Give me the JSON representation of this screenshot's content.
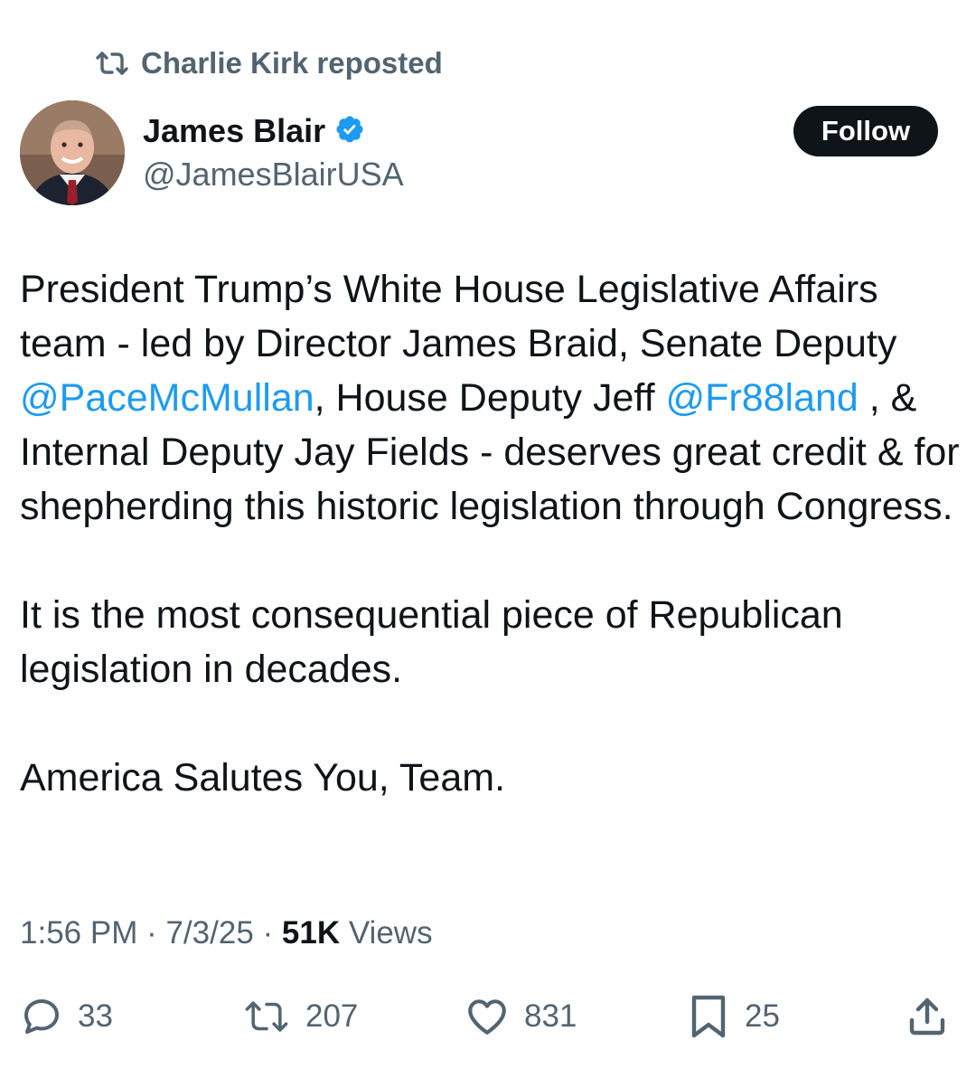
{
  "repost": {
    "icon": "repost-icon",
    "text": "Charlie Kirk reposted"
  },
  "author": {
    "display_name": "James Blair",
    "handle": "@JamesBlairUSA",
    "verified_icon": "verified-badge-icon",
    "verified_color": "#1d9bf0"
  },
  "follow_button": {
    "label": "Follow"
  },
  "tweet": {
    "p1_a": "President Trump’s White House Legislative Affairs team - led by Director James Braid, Senate Deputy ",
    "mention1": "@PaceMcMullan",
    "p1_b": ", House Deputy Jeff ",
    "mention2": "@Fr88land",
    "p1_c": " , & Internal Deputy Jay Fields - deserves great credit & for shepherding this historic legislation through Congress.",
    "p2": "It is the most consequential piece of Republican legislation in decades.",
    "p3": "America Salutes You, Team."
  },
  "meta": {
    "time": "1:56 PM",
    "sep1": " · ",
    "date": "7/3/25",
    "sep2": " · ",
    "views_count": "51K",
    "views_label": " Views"
  },
  "actions": {
    "replies": "33",
    "reposts": "207",
    "likes": "831",
    "bookmarks": "25"
  },
  "colors": {
    "text": "#0f1419",
    "secondary": "#536471",
    "link": "#1d9bf0",
    "button_bg": "#0f1419"
  }
}
